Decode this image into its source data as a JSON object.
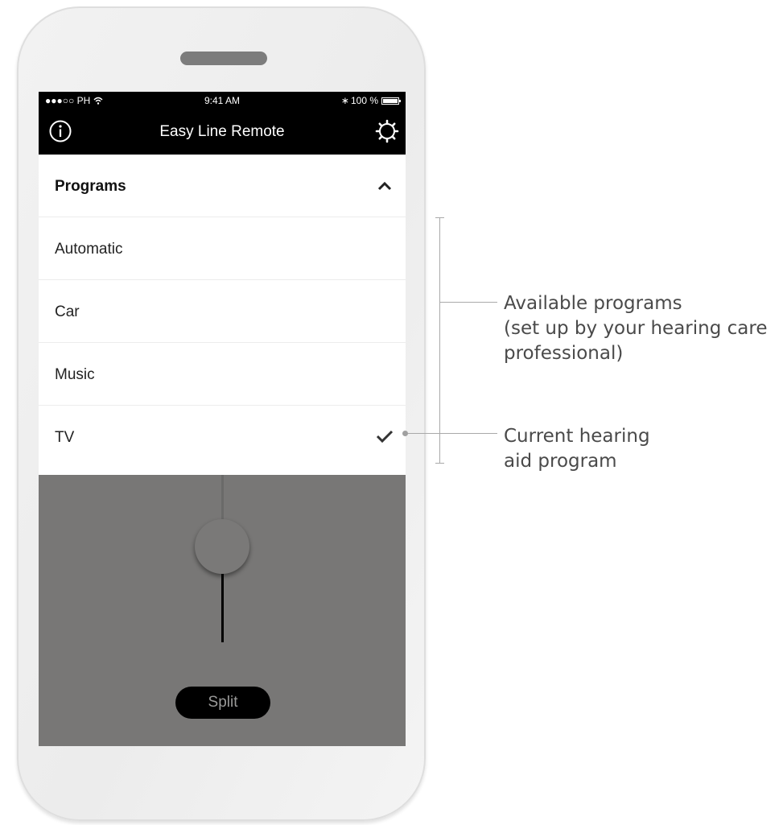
{
  "status_bar": {
    "carrier": "●●●○○ PH",
    "time": "9:41 AM",
    "bluetooth": "∗",
    "battery": "100 %"
  },
  "nav": {
    "title": "Easy Line Remote",
    "left_icon": "info-icon",
    "right_icon": "gear-icon"
  },
  "programs": {
    "header": "Programs",
    "expanded": true,
    "items": [
      {
        "label": "Automatic",
        "selected": false
      },
      {
        "label": "Car",
        "selected": false
      },
      {
        "label": "Music",
        "selected": false
      },
      {
        "label": "TV",
        "selected": true
      }
    ]
  },
  "volume": {
    "split_label": "Split"
  },
  "annotations": {
    "available": [
      "Available programs",
      "(set up by your hearing care",
      "professional)"
    ],
    "current": [
      "Current hearing",
      "aid program"
    ]
  },
  "colors": {
    "nav_bg": "#000000",
    "control_bg": "#787776",
    "annotation_line": "#a9a9a9"
  }
}
